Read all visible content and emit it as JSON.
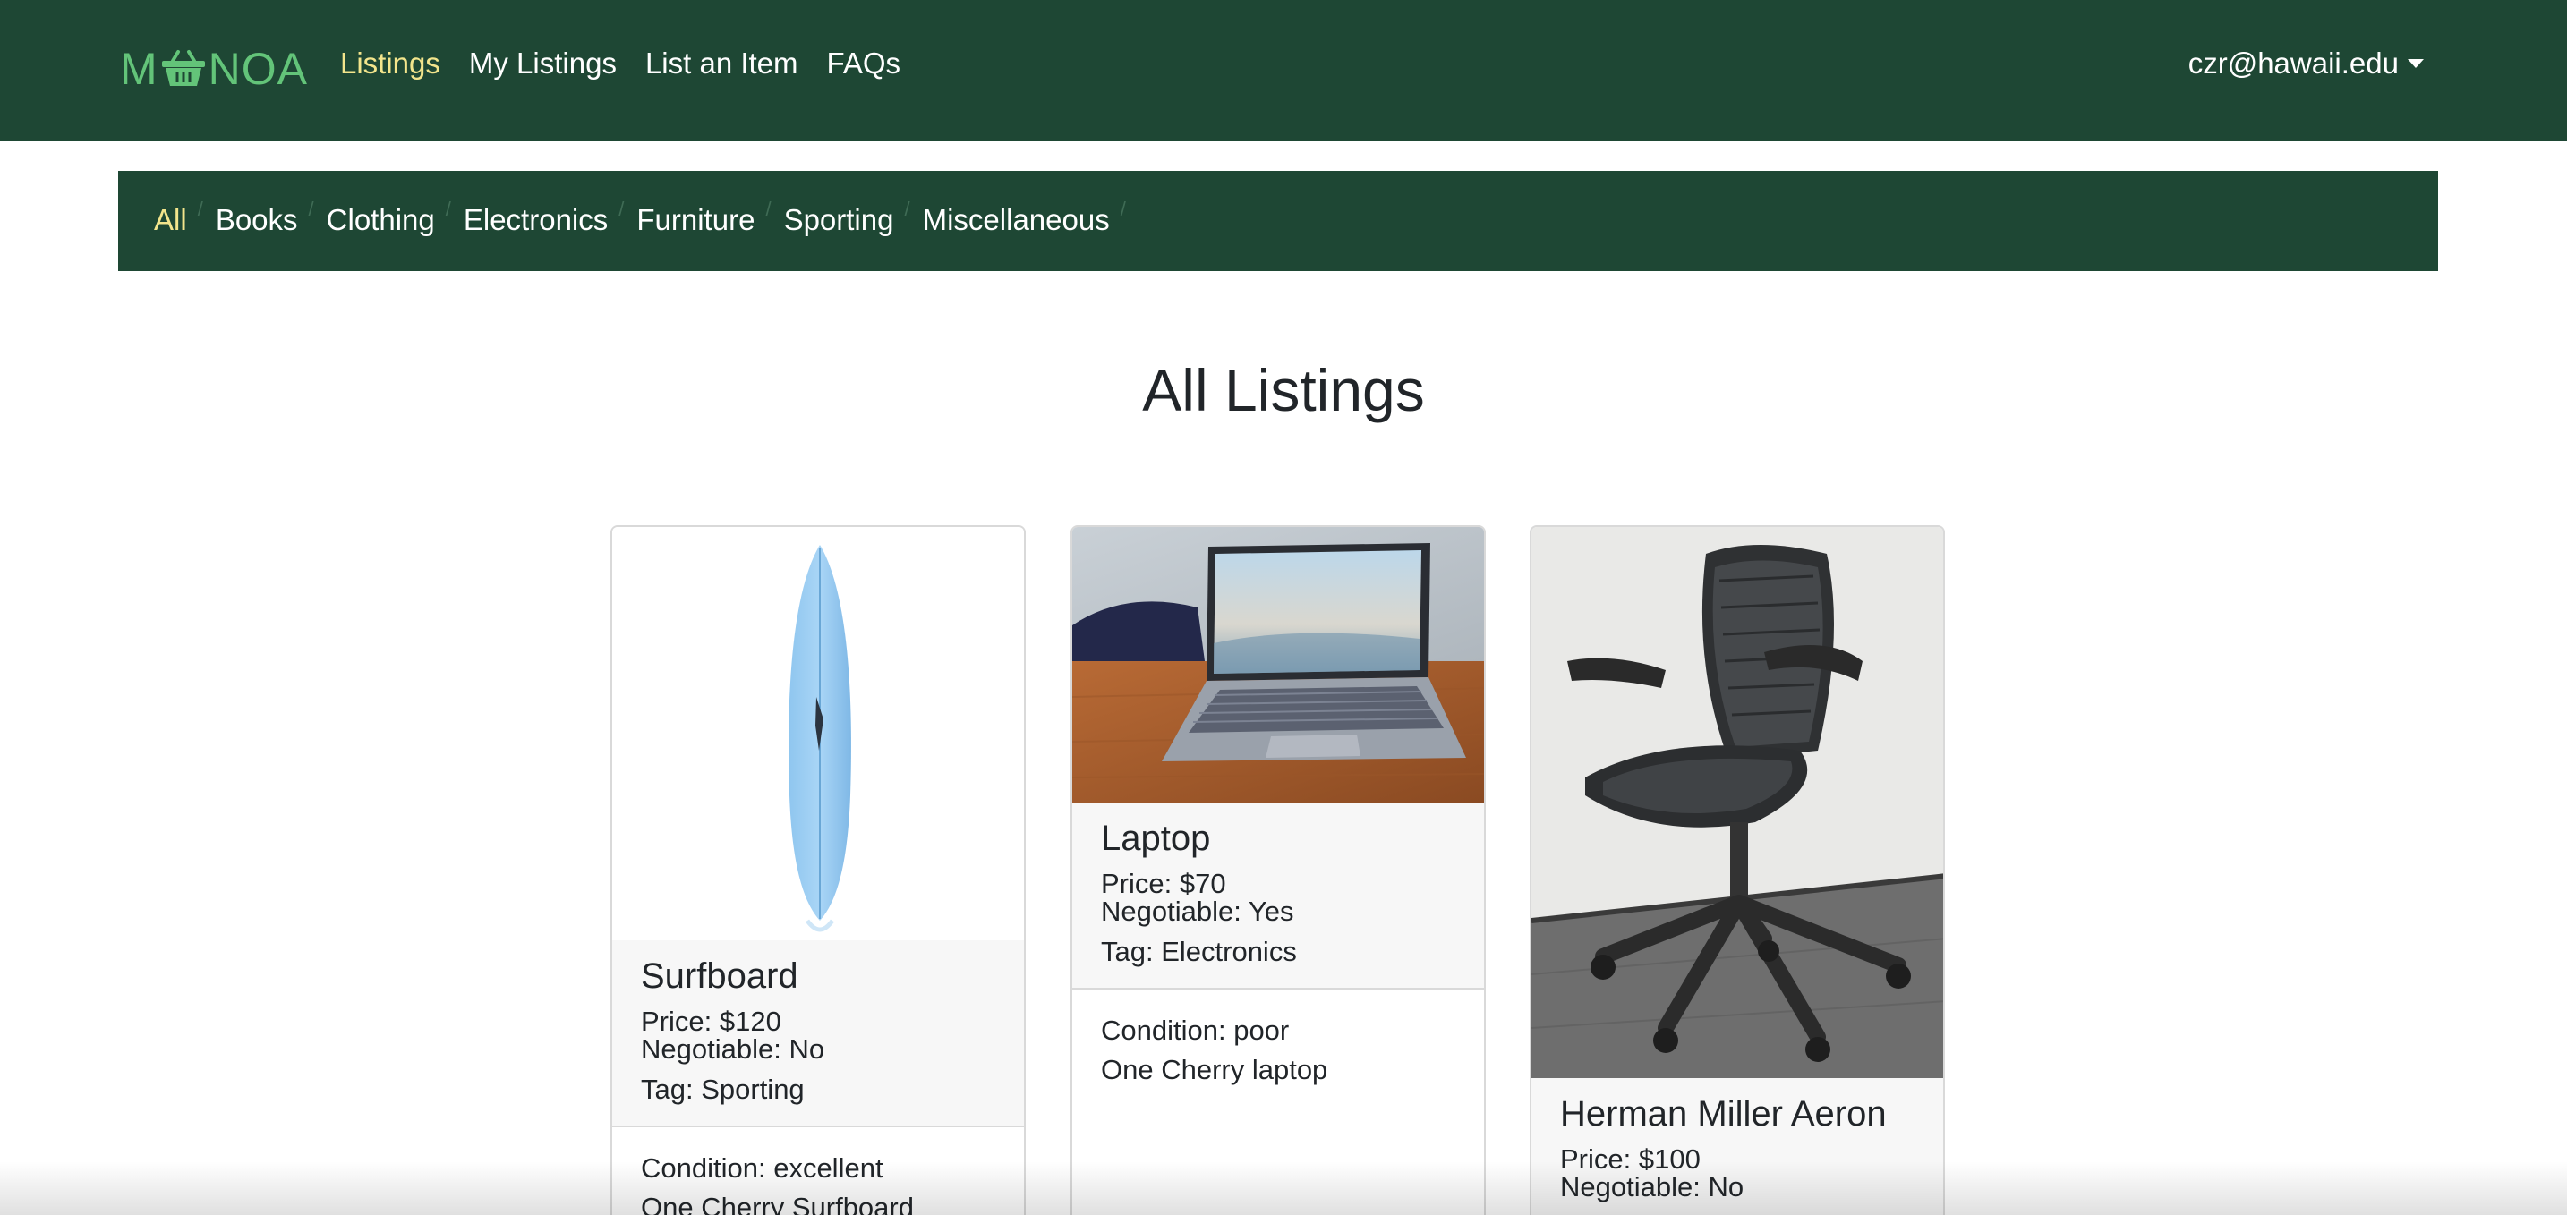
{
  "brand": {
    "text_left": "M",
    "text_right": "NOA",
    "icon": "basket-icon",
    "color": "#63c479"
  },
  "navbar": {
    "background": "#1e4734",
    "links": [
      {
        "label": "Listings",
        "active": true
      },
      {
        "label": "My Listings",
        "active": false
      },
      {
        "label": "List an Item",
        "active": false
      },
      {
        "label": "FAQs",
        "active": false
      }
    ],
    "user": {
      "email": "czr@hawaii.edu",
      "icon": "chevron-down-icon"
    }
  },
  "categories": {
    "items": [
      {
        "label": "All",
        "active": true
      },
      {
        "label": "Books",
        "active": false
      },
      {
        "label": "Clothing",
        "active": false
      },
      {
        "label": "Electronics",
        "active": false
      },
      {
        "label": "Furniture",
        "active": false
      },
      {
        "label": "Sporting",
        "active": false
      },
      {
        "label": "Miscellaneous",
        "active": false
      }
    ],
    "active_color": "#f3e58c"
  },
  "page": {
    "title": "All Listings"
  },
  "listings": [
    {
      "name": "Surfboard",
      "price": "Price: $120",
      "negotiable": "Negotiable: No",
      "tag": "Tag: Sporting",
      "condition": "Condition: excellent",
      "description": "One Cherry Surfboard",
      "image": "surfboard-image"
    },
    {
      "name": "Laptop",
      "price": "Price: $70",
      "negotiable": "Negotiable: Yes",
      "tag": "Tag: Electronics",
      "condition": "Condition: poor",
      "description": "One Cherry laptop",
      "image": "laptop-image"
    },
    {
      "name": "Herman Miller Aeron",
      "price": "Price: $100",
      "negotiable": "Negotiable: No",
      "image": "office-chair-image"
    }
  ]
}
